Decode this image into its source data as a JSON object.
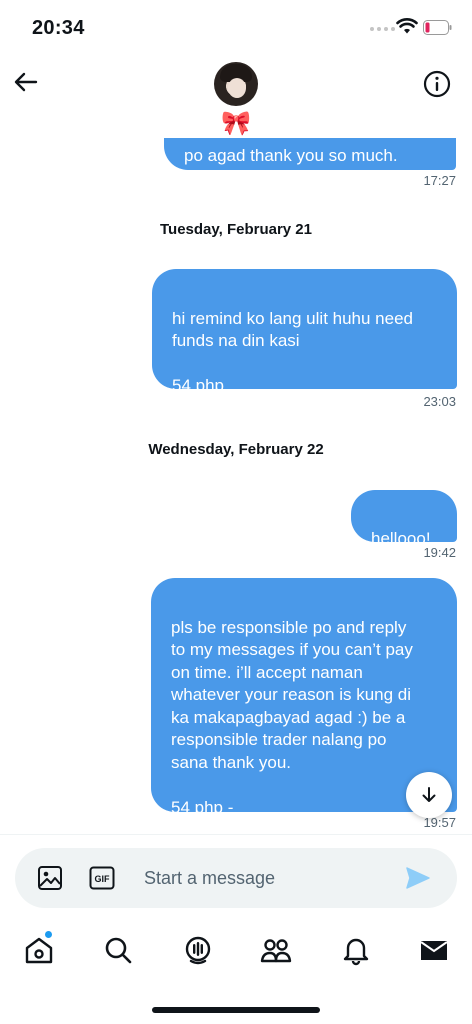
{
  "status_bar": {
    "time": "20:34"
  },
  "header": {
    "avatar_emoji": "🎀"
  },
  "messages": {
    "partial_message": {
      "text": "po agad thank you so much.",
      "time": "17:27"
    },
    "day1": {
      "label": "Tuesday, February 21"
    },
    "msg1": {
      "text": "hi remind ko lang ulit huhu need\nfunds na din kasi\n\n54 php",
      "time": "23:03"
    },
    "day2": {
      "label": "Wednesday, February 22"
    },
    "msg2": {
      "text": "hellooo!",
      "time": "19:42"
    },
    "msg3": {
      "text": "pls be responsible po and reply\nto my messages if you can’t pay\non time. i’ll accept naman\nwhatever your reason is kung di\nka makapagbayad agad :) be a\nresponsible trader nalang po\nsana thank you.\n\n54 php -",
      "time": "19:57"
    }
  },
  "composer": {
    "placeholder": "Start a message",
    "gif_label": "GIF"
  },
  "tab_bar": {
    "icons": [
      "home-icon",
      "search-icon",
      "spaces-icon",
      "communities-icon",
      "notifications-icon",
      "messages-icon"
    ],
    "home_has_badge": true
  },
  "colors": {
    "bubble": "#4a99e9",
    "accent": "#1d9bf0",
    "muted": "#536471",
    "battery_low": "#e0245e"
  }
}
